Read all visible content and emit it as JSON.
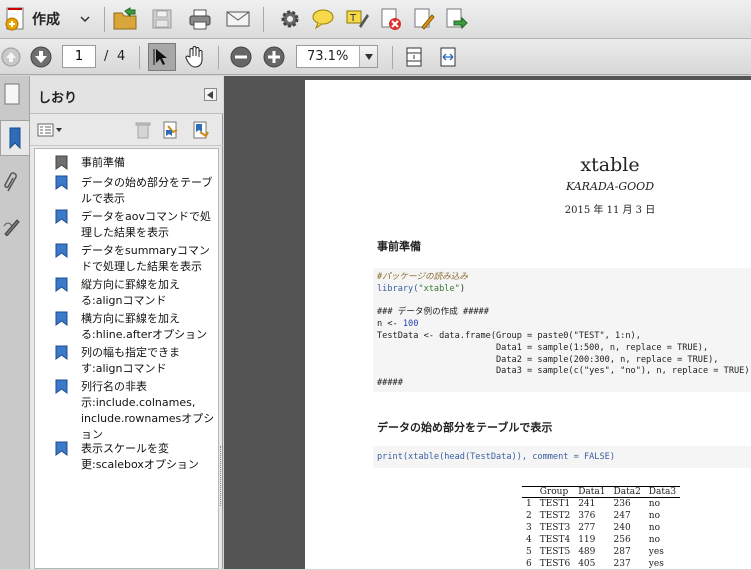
{
  "toolbar": {
    "create_label": "作成",
    "icons": [
      "create-pdf-icon",
      "open-folder-icon",
      "save-icon",
      "print-icon",
      "email-icon",
      "gear-icon",
      "comment-icon",
      "highlight-icon",
      "delete-pdf-icon",
      "sign-icon",
      "export-icon"
    ]
  },
  "nav": {
    "page_current": "1",
    "page_sep": "/",
    "page_total": "4",
    "zoom": "73.1%"
  },
  "panel": {
    "title": "しおり",
    "bookmarks": [
      {
        "label": "事前準備"
      },
      {
        "label": "データの始め部分をテーブルで表示"
      },
      {
        "label": "データをaovコマンドで処理した結果を表示"
      },
      {
        "label": "データをsummaryコマンドで処理した結果を表示"
      },
      {
        "label": "縦方向に罫線を加える:alignコマンド"
      },
      {
        "label": "横方向に罫線を加える:hline.afterオプション"
      },
      {
        "label": "列の幅も指定できます:alignコマンド"
      },
      {
        "label": "列行名の非表示:include.colnames, include.rownamesオプション"
      },
      {
        "label": "表示スケールを変更:scaleboxオプション"
      }
    ]
  },
  "doc": {
    "title": "xtable",
    "author": "KARADA-GOOD",
    "date": "2015 年 11 月 3 日",
    "section1": "事前準備",
    "code1": {
      "l1": "#パッケージの読み込み",
      "l2a": "library(",
      "l2b": "\"xtable\"",
      "l2c": ")",
      "l3": "### データ例の作成 #####",
      "l4a": "n <- ",
      "l4b": "100",
      "l5": "TestData <- data.frame(Group = paste0(\"TEST\", 1:n),",
      "l6": "                       Data1 = sample(1:500, n, replace = TRUE),",
      "l7": "                       Data2 = sample(200:300, n, replace = TRUE),",
      "l8": "                       Data3 = sample(c(\"yes\", \"no\"), n, replace = TRUE))",
      "l9": "#####"
    },
    "section2": "データの始め部分をテーブルで表示",
    "code2": "print(xtable(head(TestData)), comment = FALSE)",
    "table": {
      "headers": [
        "",
        "Group",
        "Data1",
        "Data2",
        "Data3"
      ],
      "rows": [
        [
          "1",
          "TEST1",
          "241",
          "236",
          "no"
        ],
        [
          "2",
          "TEST2",
          "376",
          "247",
          "no"
        ],
        [
          "3",
          "TEST3",
          "277",
          "240",
          "no"
        ],
        [
          "4",
          "TEST4",
          "119",
          "256",
          "no"
        ],
        [
          "5",
          "TEST5",
          "489",
          "287",
          "yes"
        ],
        [
          "6",
          "TEST6",
          "405",
          "237",
          "yes"
        ]
      ]
    }
  }
}
